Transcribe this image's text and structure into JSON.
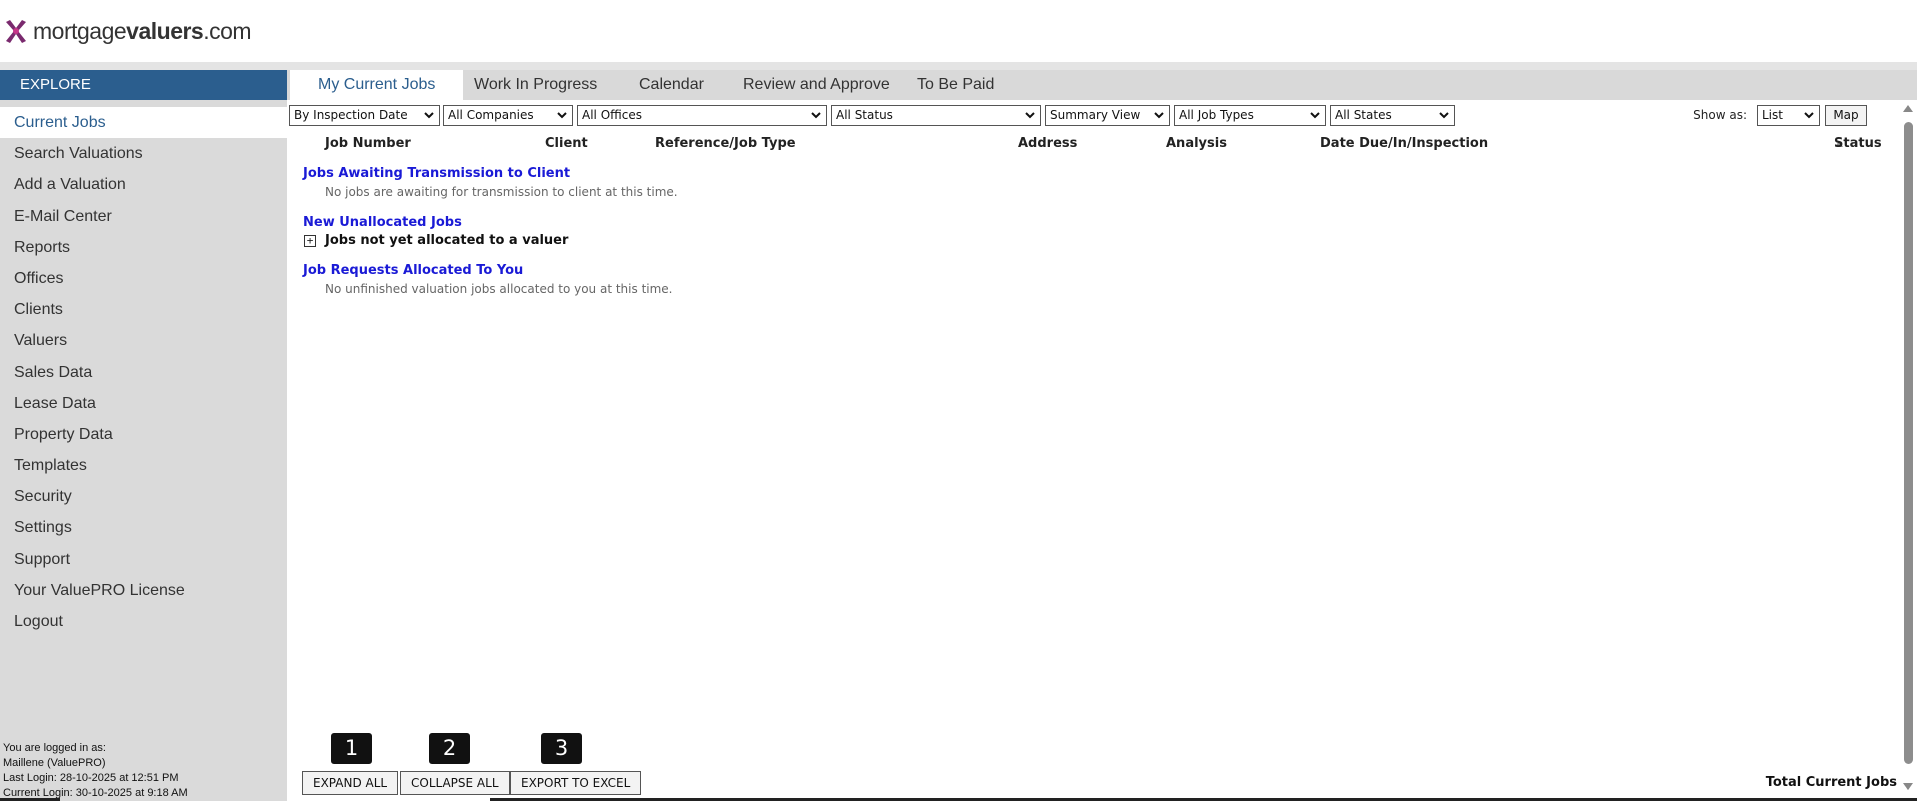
{
  "brand": {
    "name_prefix": "mortgage",
    "name_bold": "valuers",
    "name_suffix": ".com"
  },
  "sidebar": {
    "header": "EXPLORE",
    "items": [
      {
        "label": "Current Jobs",
        "active": true
      },
      {
        "label": "Search Valuations"
      },
      {
        "label": "Add a Valuation"
      },
      {
        "label": "E-Mail Center"
      },
      {
        "label": "Reports"
      },
      {
        "label": "Offices"
      },
      {
        "label": "Clients"
      },
      {
        "label": "Valuers"
      },
      {
        "label": "Sales Data"
      },
      {
        "label": "Lease Data"
      },
      {
        "label": "Property Data"
      },
      {
        "label": "Templates"
      },
      {
        "label": "Security"
      },
      {
        "label": "Settings"
      },
      {
        "label": "Support"
      },
      {
        "label": "Your ValuePRO License"
      },
      {
        "label": "Logout"
      }
    ],
    "login": {
      "line1": "You are logged in as:",
      "line2": "Maillene (ValuePRO)",
      "line3": "Last Login: 28-10-2025 at 12:51 PM",
      "line4": "Current Login: 30-10-2025 at 9:18 AM"
    }
  },
  "tabs": [
    {
      "label": "My Current Jobs",
      "active": true
    },
    {
      "label": "Work In Progress"
    },
    {
      "label": "Calendar"
    },
    {
      "label": "Review and Approve"
    },
    {
      "label": "To Be Paid"
    }
  ],
  "filters": {
    "sort": "By Inspection Date",
    "companies": "All Companies",
    "offices": "All Offices",
    "status": "All Status",
    "view": "Summary View",
    "job_types": "All Job Types",
    "states": "All States",
    "show_as_label": "Show as:",
    "show_as": "List",
    "map_button": "Map"
  },
  "columns": {
    "job_number": "Job Number",
    "client": "Client",
    "reference": "Reference/Job Type",
    "address": "Address",
    "analysis": "Analysis",
    "date": "Date Due/In/Inspection",
    "status": "Status"
  },
  "sections": {
    "awaiting_title": "Jobs Awaiting Transmission to Client",
    "awaiting_msg": "No jobs are awaiting for transmission to client at this time.",
    "unallocated_title": "New Unallocated Jobs",
    "unallocated_expander": "+",
    "unallocated_sub": "Jobs not yet allocated to a valuer",
    "allocated_title": "Job Requests Allocated To You",
    "allocated_msg": "No unfinished valuation jobs allocated to you at this time."
  },
  "footer": {
    "badges": [
      "1",
      "2",
      "3"
    ],
    "expand_all": "EXPAND ALL",
    "collapse_all": "COLLAPSE ALL",
    "export_excel": "EXPORT TO EXCEL",
    "total_label": "Total Current Jobs"
  },
  "colors": {
    "explore_bg": "#2b5e8e",
    "link_blue": "#1a1ad6",
    "brand_purple": "#7a2a6e",
    "sidebar_bg": "#dadada"
  }
}
